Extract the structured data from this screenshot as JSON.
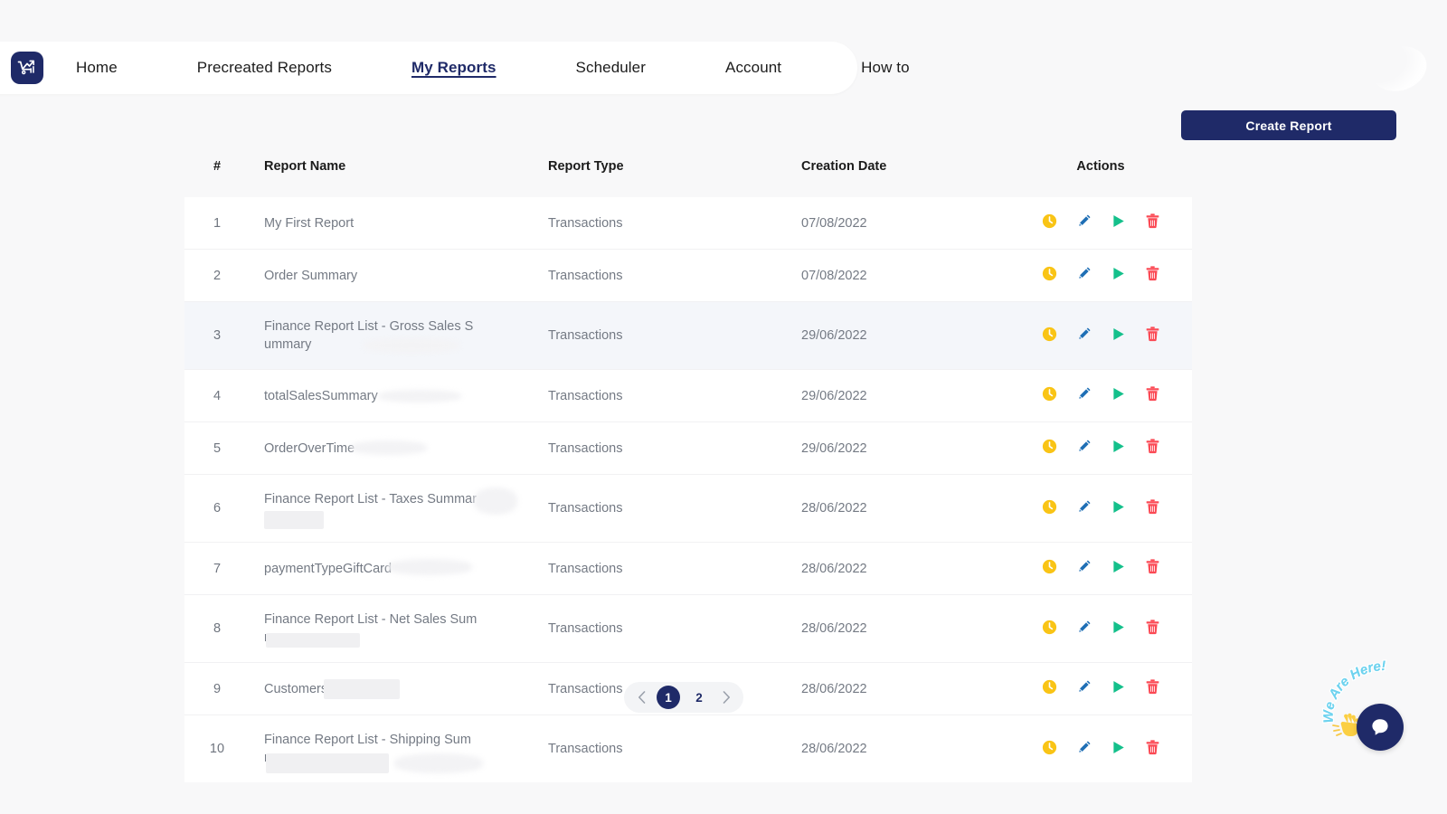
{
  "brand": {
    "logo_icon": "cart-growth-chart-logo",
    "accent": "#1f2a68"
  },
  "nav": {
    "items": [
      {
        "label": "Home",
        "active": false
      },
      {
        "label": "Precreated Reports",
        "active": false
      },
      {
        "label": "My Reports",
        "active": true
      },
      {
        "label": "Scheduler",
        "active": false
      },
      {
        "label": "Account",
        "active": false
      },
      {
        "label": "How to",
        "active": false
      }
    ]
  },
  "toolbar": {
    "create_label": "Create Report"
  },
  "table": {
    "headers": {
      "num": "#",
      "name": "Report Name",
      "type": "Report Type",
      "date": "Creation Date",
      "actions": "Actions"
    },
    "action_icons": [
      {
        "name": "schedule-clock-icon",
        "color": "#f9c416"
      },
      {
        "name": "edit-pencil-icon",
        "color": "#1f6fb5"
      },
      {
        "name": "run-play-icon",
        "color": "#14c08b"
      },
      {
        "name": "delete-trash-icon",
        "color": "#fb4a55"
      }
    ],
    "rows": [
      {
        "num": "1",
        "name": "My First Report",
        "type": "Transactions",
        "date": "07/08/2022",
        "selected": false
      },
      {
        "num": "2",
        "name": "Order Summary",
        "type": "Transactions",
        "date": "07/08/2022",
        "selected": false
      },
      {
        "num": "3",
        "name": "Finance Report List - Gross Sales Summary",
        "type": "Transactions",
        "date": "29/06/2022",
        "selected": true
      },
      {
        "num": "4",
        "name": "totalSalesSummary",
        "type": "Transactions",
        "date": "29/06/2022",
        "selected": false
      },
      {
        "num": "5",
        "name": "OrderOverTime",
        "type": "Transactions",
        "date": "29/06/2022",
        "selected": false
      },
      {
        "num": "6",
        "name": "Finance Report List - Taxes Summary",
        "type": "Transactions",
        "date": "28/06/2022",
        "selected": false
      },
      {
        "num": "7",
        "name": "paymentTypeGiftCard",
        "type": "Transactions",
        "date": "28/06/2022",
        "selected": false
      },
      {
        "num": "8",
        "name": "Finance Report List - Net Sales Summary",
        "type": "Transactions",
        "date": "28/06/2022",
        "selected": false
      },
      {
        "num": "9",
        "name": "CustomersOverTime",
        "type": "Transactions",
        "date": "28/06/2022",
        "selected": false
      },
      {
        "num": "10",
        "name": "Finance Report List - Shipping Summary",
        "type": "Transactions",
        "date": "28/06/2022",
        "selected": false
      }
    ]
  },
  "pagination": {
    "prev_icon": "chevron-left-icon",
    "next_icon": "chevron-right-icon",
    "pages": [
      {
        "label": "1",
        "active": true
      },
      {
        "label": "2",
        "active": false
      }
    ]
  },
  "chat_widget": {
    "label": "We Are Here!",
    "hand_icon": "waving-hand-icon",
    "bubble_icon": "chat-bubble-icon"
  }
}
